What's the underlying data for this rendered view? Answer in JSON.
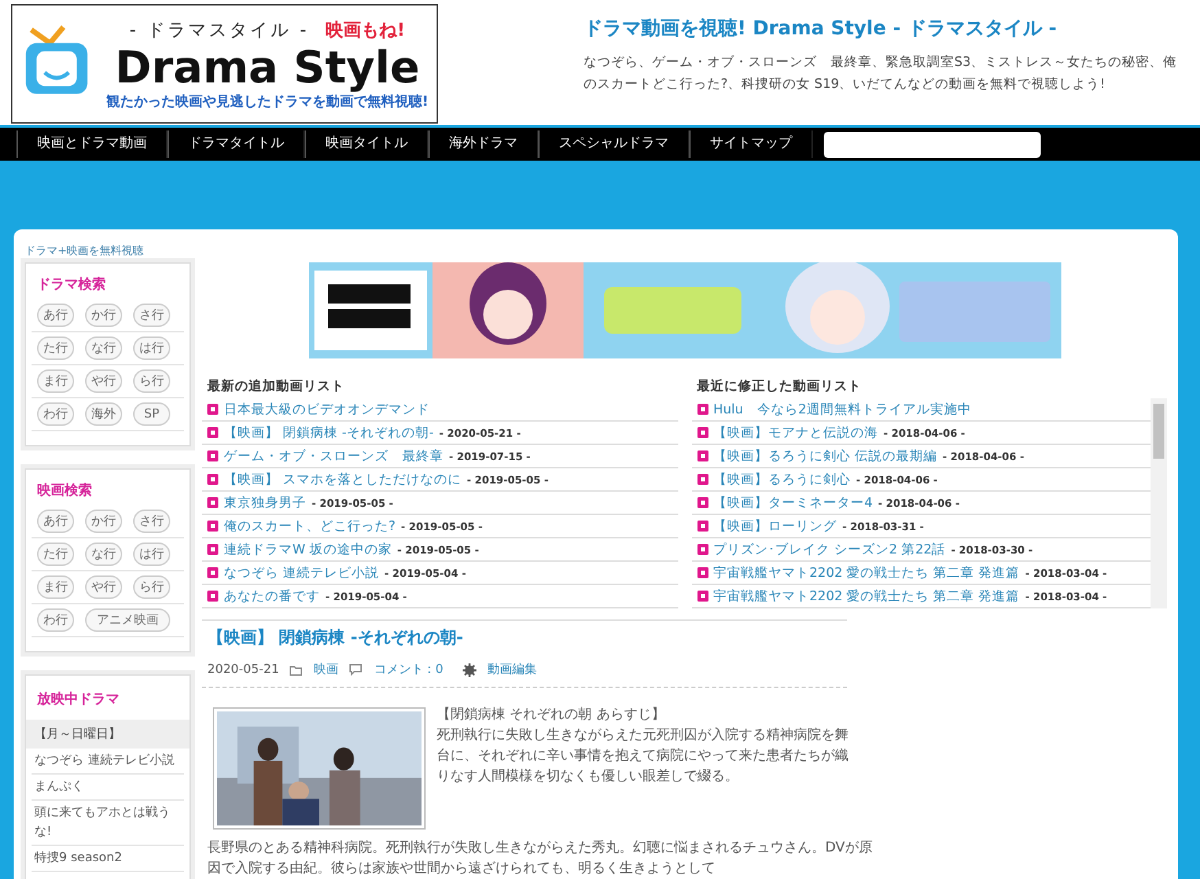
{
  "header": {
    "logo": {
      "tagline_top": "- ドラマスタイル -",
      "badge": "映画もね!",
      "name": "Drama Style",
      "tagline_bottom": "観たかった映画や見逃したドラマを動画で無料視聴!"
    },
    "site_title": "ドラマ動画を視聴! Drama Style - ドラマスタイル -",
    "description": "なつぞら、ゲーム・オブ・スローンズ　最終章、緊急取調室S3、ミストレス～女たちの秘密、俺のスカートどこ行った?、科捜研の女 S19、いだてんなどの動画を無料で視聴しよう!"
  },
  "nav": {
    "items": [
      "映画とドラマ動画",
      "ドラマタイトル",
      "映画タイトル",
      "海外ドラマ",
      "スペシャルドラマ",
      "サイトマップ"
    ],
    "has_search": true
  },
  "breadcrumb": "ドラマ+映画を無料視聴",
  "sidebar": {
    "boxes": [
      {
        "kind": "buttons",
        "title": "ドラマ検索",
        "rows": [
          [
            "あ行",
            "か行",
            "さ行"
          ],
          [
            "た行",
            "な行",
            "は行"
          ],
          [
            "ま行",
            "や行",
            "ら行"
          ],
          [
            "わ行",
            "海外",
            "SP"
          ]
        ]
      },
      {
        "kind": "buttons",
        "title": "映画検索",
        "rows": [
          [
            "あ行",
            "か行",
            "さ行"
          ],
          [
            "た行",
            "な行",
            "は行"
          ],
          [
            "ま行",
            "や行",
            "ら行"
          ],
          [
            "わ行",
            "アニメ映画"
          ]
        ]
      },
      {
        "kind": "list",
        "title": "放映中ドラマ",
        "subheading": "【月～日曜日】",
        "items": [
          "なつぞら 連続テレビ小説",
          "まんぷく",
          "頭に来てもアホとは戦うな!",
          "特捜9 season2"
        ]
      }
    ]
  },
  "lists": [
    {
      "title": "最新の追加動画リスト",
      "items": [
        {
          "title": "日本最大級のビデオオンデマンド"
        },
        {
          "title": "【映画】 閉鎖病棟 -それぞれの朝-",
          "date": "- 2020-05-21 -"
        },
        {
          "title": "ゲーム・オブ・スローンズ　最終章",
          "date": "- 2019-07-15 -"
        },
        {
          "title": "【映画】 スマホを落としただけなのに",
          "date": "- 2019-05-05 -"
        },
        {
          "title": "東京独身男子",
          "date": "- 2019-05-05 -"
        },
        {
          "title": "俺のスカート、どこ行った?",
          "date": "- 2019-05-05 -"
        },
        {
          "title": "連続ドラマW 坂の途中の家",
          "date": "- 2019-05-05 -"
        },
        {
          "title": "なつぞら 連続テレビ小説",
          "date": "- 2019-05-04 -"
        },
        {
          "title": "あなたの番です",
          "date": "- 2019-05-04 -"
        }
      ]
    },
    {
      "title": "最近に修正した動画リスト",
      "scrollbar": true,
      "items": [
        {
          "title": "Hulu　今なら2週間無料トライアル実施中"
        },
        {
          "title": "【映画】モアナと伝説の海",
          "date": "- 2018-04-06 -"
        },
        {
          "title": "【映画】るろうに剣心 伝説の最期編",
          "date": "- 2018-04-06 -"
        },
        {
          "title": "【映画】るろうに剣心",
          "date": "- 2018-04-06 -"
        },
        {
          "title": "【映画】ターミネーター4",
          "date": "- 2018-04-06 -"
        },
        {
          "title": "【映画】ローリング",
          "date": "- 2018-03-31 -"
        },
        {
          "title": "プリズン･ブレイク シーズン2 第22話",
          "date": "- 2018-03-30 -"
        },
        {
          "title": "宇宙戦艦ヤマト2202 愛の戦士たち 第二章 発進篇",
          "date": "- 2018-03-04 -"
        },
        {
          "title": "宇宙戦艦ヤマト2202 愛の戦士たち 第二章 発進篇",
          "date": "- 2018-03-04 -"
        }
      ]
    }
  ],
  "article": {
    "title": "【映画】 閉鎖病棟 -それぞれの朝-",
    "date": "2020-05-21",
    "category": "映画",
    "comments": "コメント : 0",
    "edit": "動画編集",
    "synopsis_heading": "【閉鎖病棟 それぞれの朝 あらすじ】",
    "synopsis": "死刑執行に失敗し生きながらえた元死刑囚が入院する精神病院を舞台に、それぞれに辛い事情を抱えて病院にやって来た患者たちが織りなす人間模様を切なくも優しい眼差しで綴る。",
    "body": "長野県のとある精神科病院。死刑執行が失敗し生きながらえた秀丸。幻聴に悩まされるチュウさん。DVが原因で入院する由紀。彼らは家族や世間から遠ざけられても、明るく生きようとして"
  }
}
